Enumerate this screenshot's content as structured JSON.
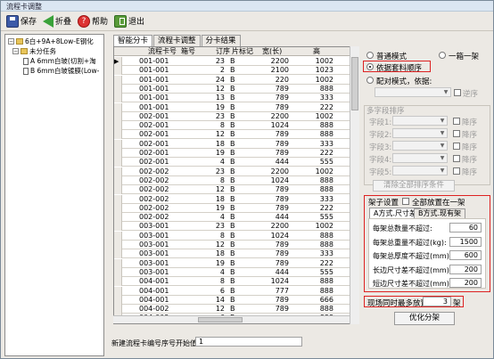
{
  "window": {
    "title": "流程卡调整"
  },
  "toolbar": {
    "save": "保存",
    "fold": "折叠",
    "help": "帮助",
    "exit": "退出"
  },
  "tree": {
    "root": "6白+9A+8Low-E钢化",
    "group": "未分任务",
    "item_a": "A 6mm白玻(切割+淘",
    "item_b": "B 6mm白玻镀膜(Low-"
  },
  "tabs": [
    "智能分卡",
    "流程卡调整",
    "分卡结果"
  ],
  "grid": {
    "headers": [
      "流程卡号",
      "箱号",
      "订序",
      "片标记",
      "宽(长)",
      "高"
    ],
    "rows": [
      [
        "001-001",
        "",
        "23",
        "B",
        "2200",
        "1002"
      ],
      [
        "001-001",
        "",
        "2",
        "B",
        "2100",
        "1023"
      ],
      [
        "001-001",
        "",
        "24",
        "B",
        "220",
        "1002"
      ],
      [
        "001-001",
        "",
        "12",
        "B",
        "789",
        "888"
      ],
      [
        "001-001",
        "",
        "13",
        "B",
        "789",
        "333"
      ],
      [
        "001-001",
        "",
        "19",
        "B",
        "789",
        "222"
      ],
      [
        "002-001",
        "",
        "23",
        "B",
        "2200",
        "1002"
      ],
      [
        "002-001",
        "",
        "8",
        "B",
        "1024",
        "888"
      ],
      [
        "002-001",
        "",
        "12",
        "B",
        "789",
        "888"
      ],
      [
        "002-001",
        "",
        "18",
        "B",
        "789",
        "333"
      ],
      [
        "002-001",
        "",
        "19",
        "B",
        "789",
        "222"
      ],
      [
        "002-001",
        "",
        "4",
        "B",
        "444",
        "555"
      ],
      [
        "002-002",
        "",
        "23",
        "B",
        "2200",
        "1002"
      ],
      [
        "002-002",
        "",
        "8",
        "B",
        "1024",
        "888"
      ],
      [
        "002-002",
        "",
        "12",
        "B",
        "789",
        "888"
      ],
      [
        "002-002",
        "",
        "18",
        "B",
        "789",
        "333"
      ],
      [
        "002-002",
        "",
        "19",
        "B",
        "789",
        "222"
      ],
      [
        "002-002",
        "",
        "4",
        "B",
        "444",
        "555"
      ],
      [
        "003-001",
        "",
        "23",
        "B",
        "2200",
        "1002"
      ],
      [
        "003-001",
        "",
        "8",
        "B",
        "1024",
        "888"
      ],
      [
        "003-001",
        "",
        "12",
        "B",
        "789",
        "888"
      ],
      [
        "003-001",
        "",
        "18",
        "B",
        "789",
        "333"
      ],
      [
        "003-001",
        "",
        "19",
        "B",
        "789",
        "222"
      ],
      [
        "003-001",
        "",
        "4",
        "B",
        "444",
        "555"
      ],
      [
        "004-001",
        "",
        "8",
        "B",
        "1024",
        "888"
      ],
      [
        "004-001",
        "",
        "6",
        "B",
        "777",
        "888"
      ],
      [
        "004-001",
        "",
        "14",
        "B",
        "789",
        "666"
      ],
      [
        "004-002",
        "",
        "12",
        "B",
        "789",
        "888"
      ],
      [
        "004-002",
        "",
        "6",
        "B",
        "",
        "888"
      ]
    ]
  },
  "options": {
    "normal": "普通模式",
    "one_frame": "一箱一架",
    "by_order": "依据套料顺序",
    "config_mode": "配对模式，依据:",
    "reverse": "逆序",
    "sort_title": "多字段排序",
    "fields": [
      "字段1:",
      "字段2:",
      "字段3:",
      "字段4:",
      "字段5:"
    ],
    "desc": "降序",
    "clear": "清除全部排序条件"
  },
  "rack": {
    "title": "架子设置",
    "all_in_one": "全部放置在一架",
    "tab_a": "A方式.尺寸差",
    "tab_b": "B方式.现有架",
    "labels": [
      "每架总数量不超过:",
      "每架总重量不超过(kg):",
      "每架总厚度不超过(mm):",
      "长边尺寸差不超过(mm):",
      "短边尺寸差不超过(mm):"
    ],
    "values": [
      "60",
      "1500",
      "600",
      "200",
      "200"
    ]
  },
  "site": {
    "label": "现场同时最多放置",
    "value": "3",
    "unit": "架"
  },
  "optimize": "优化分架",
  "bottom": {
    "label": "新建流程卡编号序号开始值:",
    "value": "1"
  }
}
